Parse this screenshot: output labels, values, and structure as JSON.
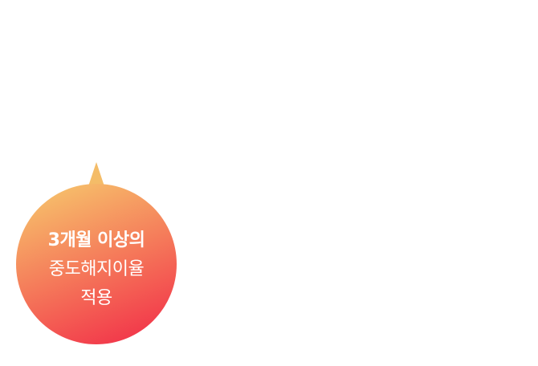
{
  "badge": {
    "line1": "3개월 이상의",
    "line2": "중도해지이율",
    "line3": "적용",
    "gradient_start": "#F6BE6A",
    "gradient_mid": "#F57A5A",
    "gradient_end": "#F2364A",
    "text_color": "#FFFFFF"
  }
}
